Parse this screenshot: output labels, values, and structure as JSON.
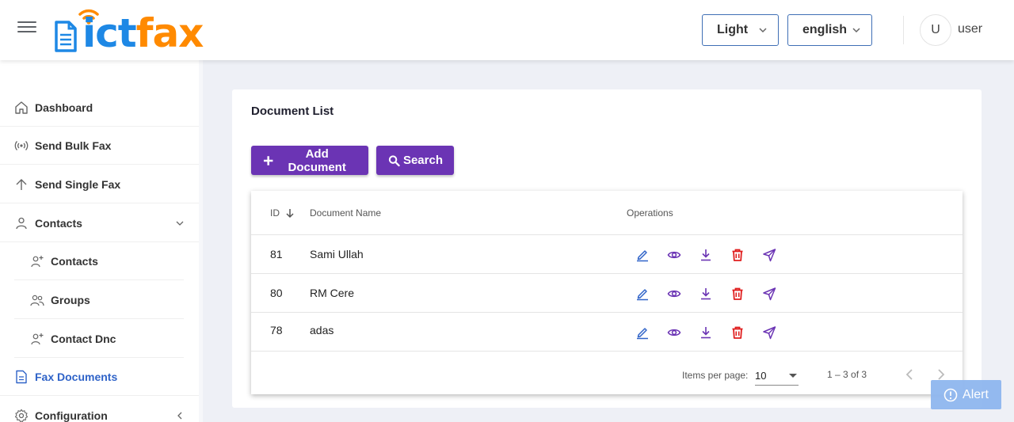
{
  "header": {
    "logo_part1": "ict",
    "logo_part2": "fax",
    "theme_select": "Light",
    "language_select": "english",
    "avatar_initial": "U",
    "username": "user"
  },
  "sidebar": {
    "items": [
      {
        "label": "Dashboard",
        "icon": "home-icon"
      },
      {
        "label": "Send Bulk Fax",
        "icon": "broadcast-icon"
      },
      {
        "label": "Send Single Fax",
        "icon": "arrow-up-icon"
      },
      {
        "label": "Contacts",
        "icon": "person-icon"
      },
      {
        "label": "Contacts",
        "icon": "person-add-icon"
      },
      {
        "label": "Groups",
        "icon": "group-icon"
      },
      {
        "label": "Contact Dnc",
        "icon": "person-add-icon"
      },
      {
        "label": "Fax Documents",
        "icon": "document-icon"
      },
      {
        "label": "Configuration",
        "icon": "settings-icon"
      }
    ]
  },
  "main": {
    "title": "Document List",
    "add_button": "Add Document",
    "search_button": "Search",
    "table": {
      "columns": [
        "ID",
        "Document Name",
        "Operations"
      ],
      "rows": [
        {
          "id": "81",
          "name": "Sami Ullah"
        },
        {
          "id": "80",
          "name": "RM Cere"
        },
        {
          "id": "78",
          "name": "adas"
        }
      ]
    },
    "paginator": {
      "items_per_page_label": "Items per page:",
      "page_size": "10",
      "range": "1 – 3 of 3"
    }
  },
  "alert_button": "Alert",
  "colors": {
    "primary_button": "#6b34b4",
    "edit_icon": "#2f63c8",
    "view_icon": "#6b34b4",
    "delete_icon": "#e01e1e",
    "logo_blue": "#1e88e5",
    "logo_orange": "#ff8a00"
  }
}
